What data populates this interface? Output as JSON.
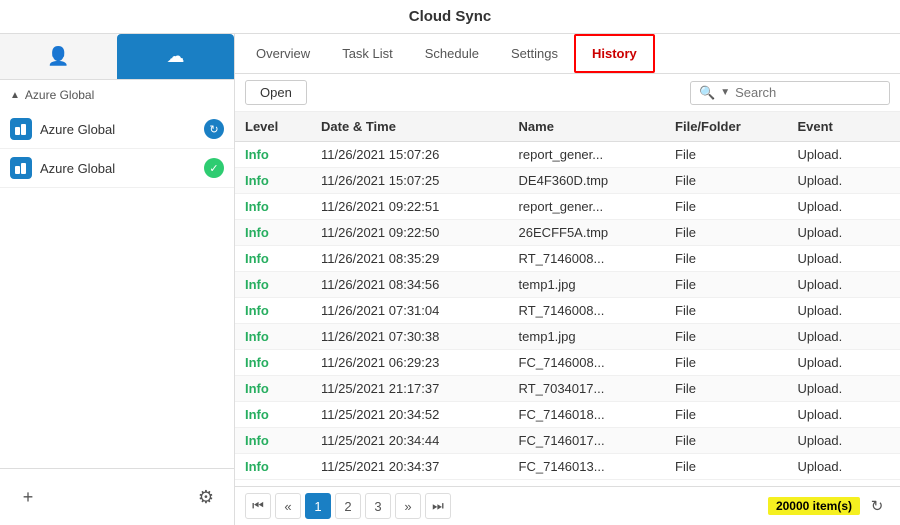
{
  "app": {
    "title": "Cloud Sync"
  },
  "sidebar": {
    "section_label": "Azure Global",
    "items": [
      {
        "id": "azure-global-1",
        "label": "Azure Global",
        "status": "sync"
      },
      {
        "id": "azure-global-2",
        "label": "Azure Global",
        "status": "ok"
      }
    ],
    "add_label": "+",
    "settings_label": "⚙"
  },
  "tabs": [
    {
      "id": "overview",
      "label": "Overview"
    },
    {
      "id": "tasklist",
      "label": "Task List"
    },
    {
      "id": "schedule",
      "label": "Schedule"
    },
    {
      "id": "settings",
      "label": "Settings"
    },
    {
      "id": "history",
      "label": "History",
      "active": true
    }
  ],
  "toolbar": {
    "open_label": "Open",
    "search_placeholder": "Search"
  },
  "table": {
    "columns": [
      "Level",
      "Date & Time",
      "Name",
      "File/Folder",
      "Event"
    ],
    "rows": [
      {
        "level": "Info",
        "datetime": "11/26/2021 15:07:26",
        "name": "report_gener...",
        "filefolder": "File",
        "event": "Upload."
      },
      {
        "level": "Info",
        "datetime": "11/26/2021 15:07:25",
        "name": "DE4F360D.tmp",
        "filefolder": "File",
        "event": "Upload."
      },
      {
        "level": "Info",
        "datetime": "11/26/2021 09:22:51",
        "name": "report_gener...",
        "filefolder": "File",
        "event": "Upload."
      },
      {
        "level": "Info",
        "datetime": "11/26/2021 09:22:50",
        "name": "26ECFF5A.tmp",
        "filefolder": "File",
        "event": "Upload."
      },
      {
        "level": "Info",
        "datetime": "11/26/2021 08:35:29",
        "name": "RT_7146008...",
        "filefolder": "File",
        "event": "Upload."
      },
      {
        "level": "Info",
        "datetime": "11/26/2021 08:34:56",
        "name": "temp1.jpg",
        "filefolder": "File",
        "event": "Upload."
      },
      {
        "level": "Info",
        "datetime": "11/26/2021 07:31:04",
        "name": "RT_7146008...",
        "filefolder": "File",
        "event": "Upload."
      },
      {
        "level": "Info",
        "datetime": "11/26/2021 07:30:38",
        "name": "temp1.jpg",
        "filefolder": "File",
        "event": "Upload."
      },
      {
        "level": "Info",
        "datetime": "11/26/2021 06:29:23",
        "name": "FC_7146008...",
        "filefolder": "File",
        "event": "Upload."
      },
      {
        "level": "Info",
        "datetime": "11/25/2021 21:17:37",
        "name": "RT_7034017...",
        "filefolder": "File",
        "event": "Upload."
      },
      {
        "level": "Info",
        "datetime": "11/25/2021 20:34:52",
        "name": "FC_7146018...",
        "filefolder": "File",
        "event": "Upload."
      },
      {
        "level": "Info",
        "datetime": "11/25/2021 20:34:44",
        "name": "FC_7146017...",
        "filefolder": "File",
        "event": "Upload."
      },
      {
        "level": "Info",
        "datetime": "11/25/2021 20:34:37",
        "name": "FC_7146013...",
        "filefolder": "File",
        "event": "Upload."
      }
    ]
  },
  "pagination": {
    "first_label": "⏮",
    "prev_label": "«",
    "pages": [
      "1",
      "2",
      "3"
    ],
    "next_label": "»",
    "last_label": "⏭",
    "active_page": "1",
    "items_count": "20000 item(s)"
  }
}
